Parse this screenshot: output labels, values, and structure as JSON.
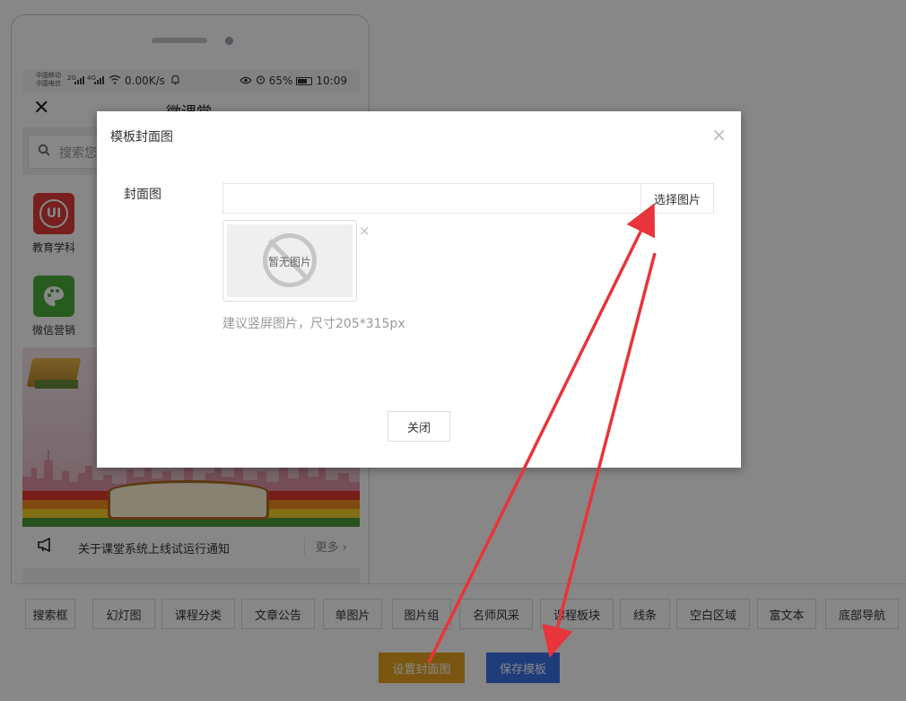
{
  "phone": {
    "status": {
      "carrier1": "中国移动",
      "carrier2": "中国电信",
      "net1": "2G",
      "net2": "4G",
      "speed": "0.00K/s",
      "battery": "65%",
      "time": "10:09"
    },
    "nav_title": "微课堂",
    "search_placeholder": "搜索您",
    "categories": [
      {
        "label": "教育学科",
        "icon_text": "UI",
        "color": "#e23b3b"
      },
      {
        "label": "微信营销",
        "icon_text": "",
        "color": "#4caf3a"
      }
    ],
    "notice": {
      "text": "关于课堂系统上线试运行通知",
      "more": "更多 ›"
    }
  },
  "toolbar": {
    "components": [
      "搜索框",
      "幻灯图",
      "课程分类",
      "文章公告",
      "单图片",
      "图片组",
      "名师风采",
      "课程板块",
      "线条",
      "空白区域",
      "富文本",
      "底部导航"
    ],
    "set_cover_label": "设置封面图",
    "save_label": "保存模板"
  },
  "modal": {
    "title": "模板封面图",
    "close_glyph": "×",
    "field_label": "封面图",
    "input_value": "",
    "choose_label": "选择图片",
    "no_image_text": "暂无图片",
    "remove_glyph": "×",
    "hint": "建议竖屏图片，尺寸205*315px",
    "close_button_label": "关闭"
  },
  "colors": {
    "cover_button": "#e8a320",
    "save_button": "#3c72e6",
    "arrow": "#e8343a"
  }
}
